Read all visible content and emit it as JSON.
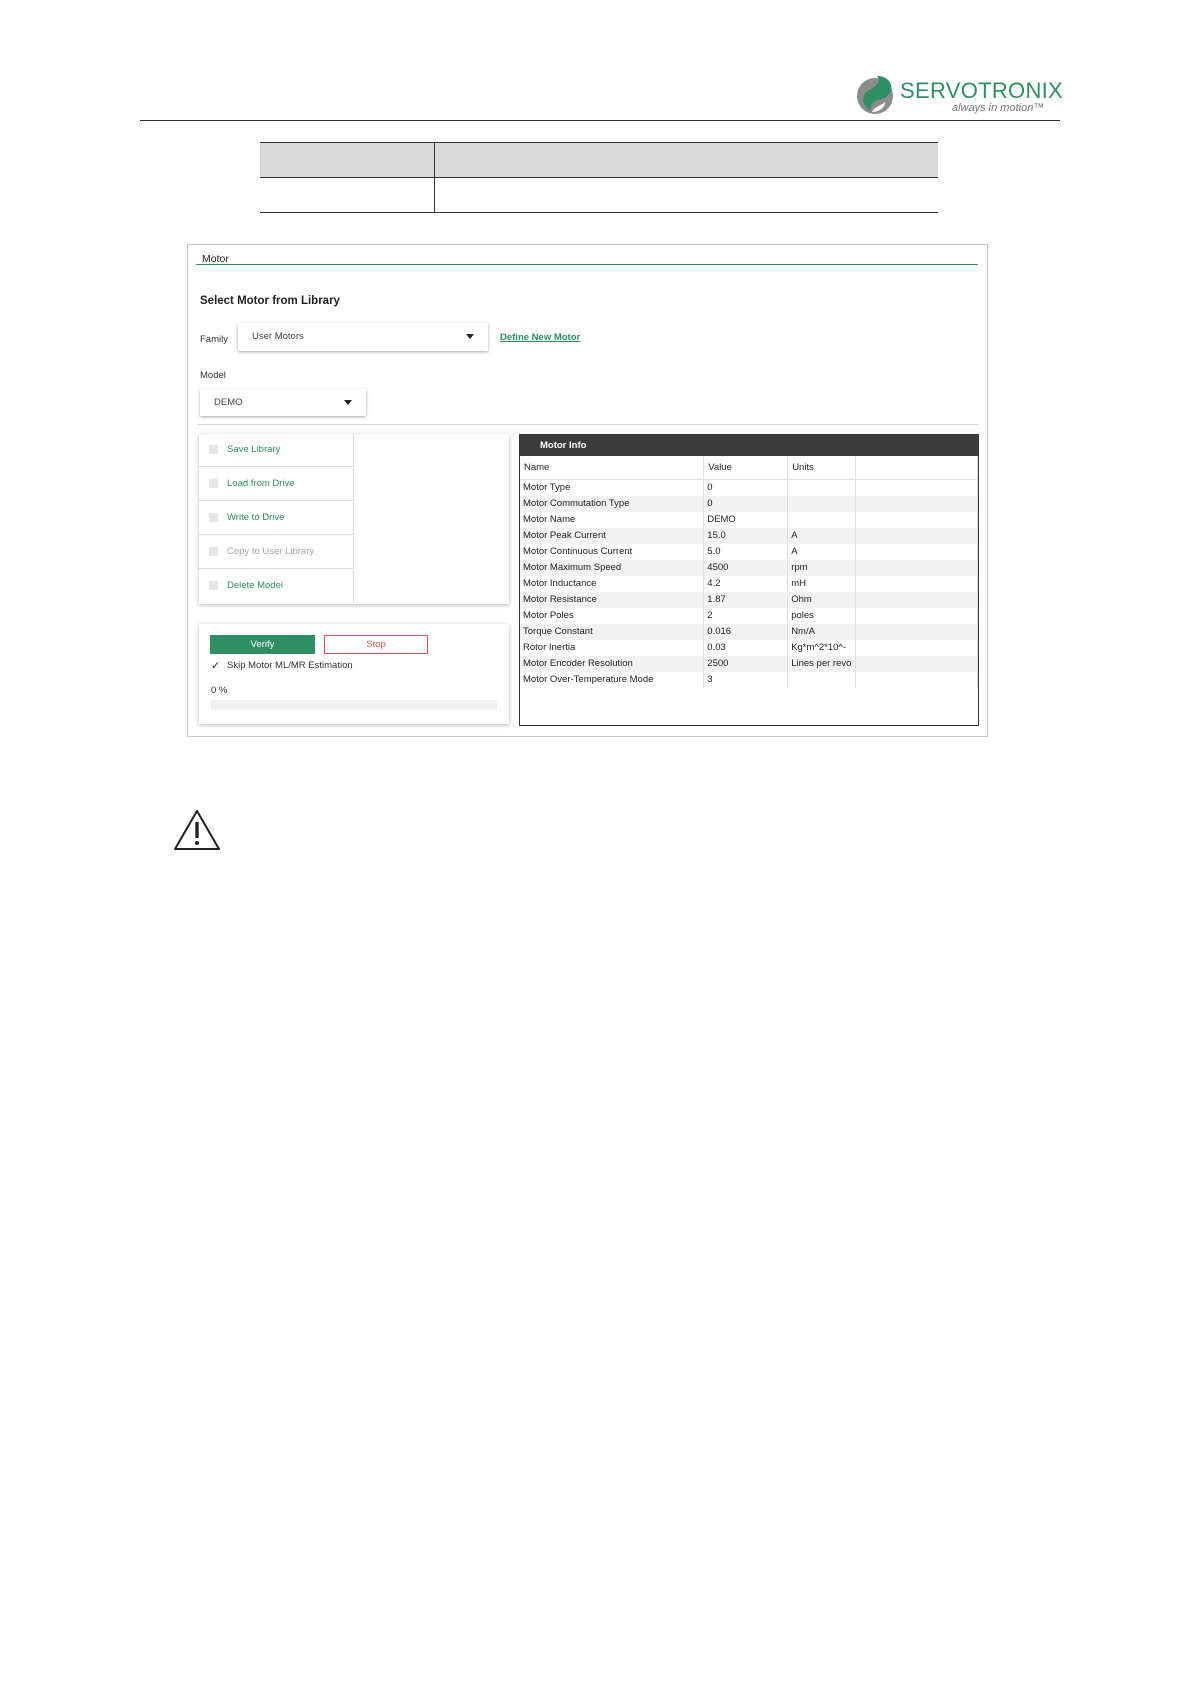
{
  "page_header": {
    "brand_name": "SERVOTRONIX",
    "tagline": "always in motion™",
    "brand_color": "#2e8f63"
  },
  "doc_table": {
    "rows": [
      [
        "",
        ""
      ],
      [
        "",
        ""
      ]
    ]
  },
  "motor_panel": {
    "title": "Motor",
    "section_heading": "Select Motor from Library",
    "family_label": "Family",
    "family_value": "User Motors",
    "define_new_motor_label": "Define New Motor",
    "model_label": "Model",
    "model_value": "DEMO",
    "actions": [
      {
        "label": "Save Library",
        "enabled": true
      },
      {
        "label": "Load from Drive",
        "enabled": true
      },
      {
        "label": "Write to Drive",
        "enabled": true
      },
      {
        "label": "Copy to User Library",
        "enabled": false
      },
      {
        "label": "Delete Model",
        "enabled": true
      }
    ],
    "verify_label": "Verify",
    "stop_label": "Stop",
    "skip_estimation_label": "Skip Motor ML/MR Estimation",
    "skip_estimation_checked": true,
    "progress_text": "0 %",
    "progress_fraction": 0,
    "motor_info": {
      "title": "Motor Info",
      "columns": [
        "Name",
        "Value",
        "Units",
        ""
      ],
      "rows": [
        [
          "Motor Type",
          "0",
          ""
        ],
        [
          "Motor Commutation Type",
          "0",
          ""
        ],
        [
          "Motor Name",
          "DEMO",
          ""
        ],
        [
          "Motor Peak Current",
          "15.0",
          "A"
        ],
        [
          "Motor Continuous Current",
          "5.0",
          "A"
        ],
        [
          "Motor Maximum Speed",
          "4500",
          "rpm"
        ],
        [
          "Motor Inductance",
          "4.2",
          "mH"
        ],
        [
          "Motor Resistance",
          "1.87",
          "Ohm"
        ],
        [
          "Motor Poles",
          "2",
          "poles"
        ],
        [
          "Torque Constant",
          "0.016",
          "Nm/A"
        ],
        [
          "Rotor Inertia",
          "0.03",
          "Kg*m^2*10^-"
        ],
        [
          "Motor Encoder Resolution",
          "2500",
          "Lines per revo"
        ],
        [
          "Motor Over-Temperature Mode",
          "3",
          ""
        ]
      ]
    }
  },
  "icons": {
    "logo": "servotronix-logo-icon",
    "warning": "warning-triangle-icon"
  }
}
